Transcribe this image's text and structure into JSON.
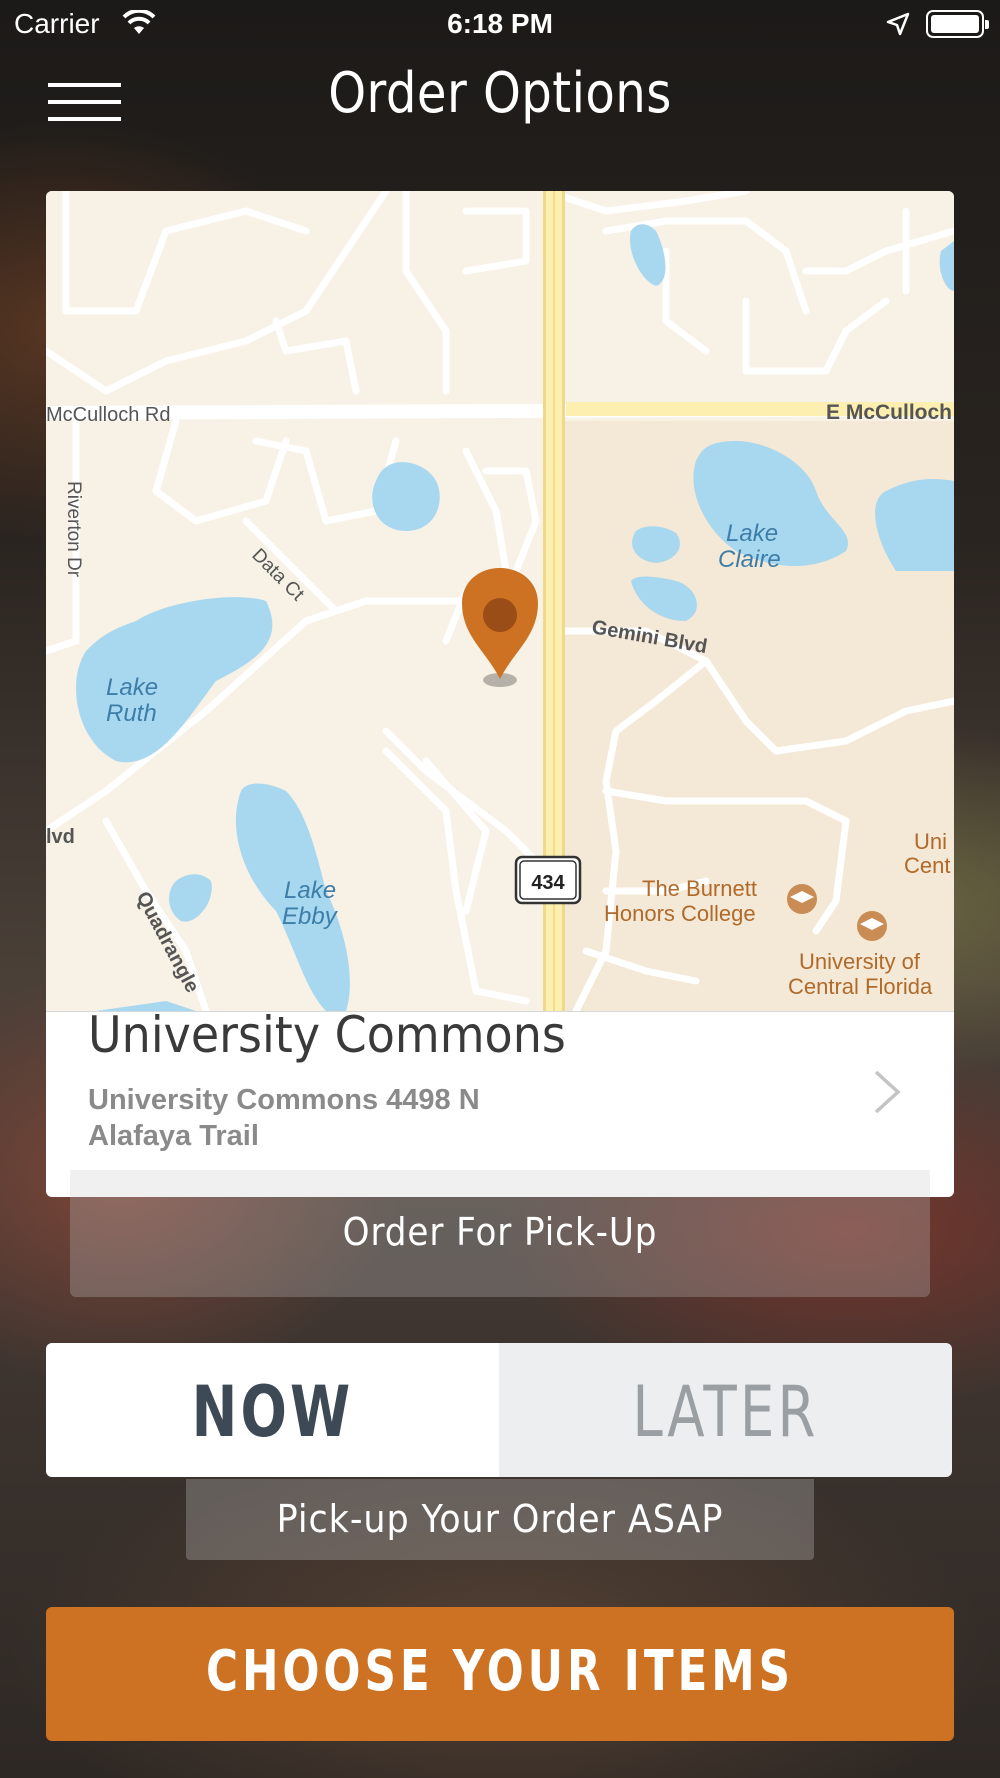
{
  "status_bar": {
    "carrier": "Carrier",
    "time": "6:18 PM"
  },
  "nav": {
    "title": "Order Options"
  },
  "map": {
    "streets": {
      "mcculloch_w": "McCulloch Rd",
      "mcculloch_e": "E McCulloch",
      "riverton": "Riverton Dr",
      "data_ct": "Data Ct",
      "gemini": "Gemini Blvd",
      "blvd": "lvd",
      "quadrangle": "Quadrangle"
    },
    "lakes": {
      "ruth_1": "Lake",
      "ruth_2": "Ruth",
      "ebby_1": "Lake",
      "ebby_2": "Ebby",
      "claire_1": "Lake",
      "claire_2": "Claire"
    },
    "route_shield": "434",
    "pois": {
      "burnett_1": "The Burnett",
      "burnett_2": "Honors College",
      "ucf_1": "University of",
      "ucf_2": "Central Florida",
      "uni_1": "Uni",
      "uni_2": "Cent"
    },
    "colors": {
      "land": "#f7f1e6",
      "campus": "#f4e8d6",
      "water": "#a8d8ef",
      "highway": "#fcefb0",
      "pin": "#cd7122"
    }
  },
  "location": {
    "name": "University Commons",
    "address": "University Commons 4498 N Alafaya Trail"
  },
  "order_type": {
    "label": "Order For Pick-Up"
  },
  "timing": {
    "now_label": "NOW",
    "later_label": "LATER",
    "selected": "NOW",
    "description": "Pick-up Your Order ASAP"
  },
  "cta": {
    "label": "CHOOSE YOUR ITEMS",
    "color": "#cd7122"
  }
}
